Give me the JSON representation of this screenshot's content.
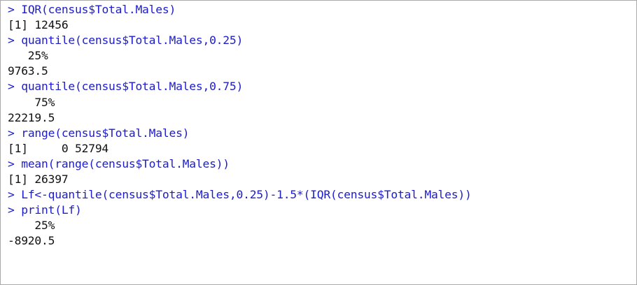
{
  "console": {
    "prompt": ">",
    "lines": [
      {
        "type": "input",
        "text": "IQR(census$Total.Males)"
      },
      {
        "type": "output",
        "text": "[1] 12456"
      },
      {
        "type": "input",
        "text": "quantile(census$Total.Males,0.25)"
      },
      {
        "type": "output",
        "text": "   25%"
      },
      {
        "type": "output",
        "text": "9763.5"
      },
      {
        "type": "input",
        "text": "quantile(census$Total.Males,0.75)"
      },
      {
        "type": "output",
        "text": "    75%"
      },
      {
        "type": "output",
        "text": "22219.5"
      },
      {
        "type": "input",
        "text": "range(census$Total.Males)"
      },
      {
        "type": "output",
        "text": "[1]     0 52794"
      },
      {
        "type": "input",
        "text": "mean(range(census$Total.Males))"
      },
      {
        "type": "output",
        "text": "[1] 26397"
      },
      {
        "type": "input",
        "text": "Lf<-quantile(census$Total.Males,0.25)-1.5*(IQR(census$Total.Males))"
      },
      {
        "type": "input",
        "text": "print(Lf)"
      },
      {
        "type": "output",
        "text": "    25%"
      },
      {
        "type": "output",
        "text": "-8920.5"
      }
    ]
  }
}
